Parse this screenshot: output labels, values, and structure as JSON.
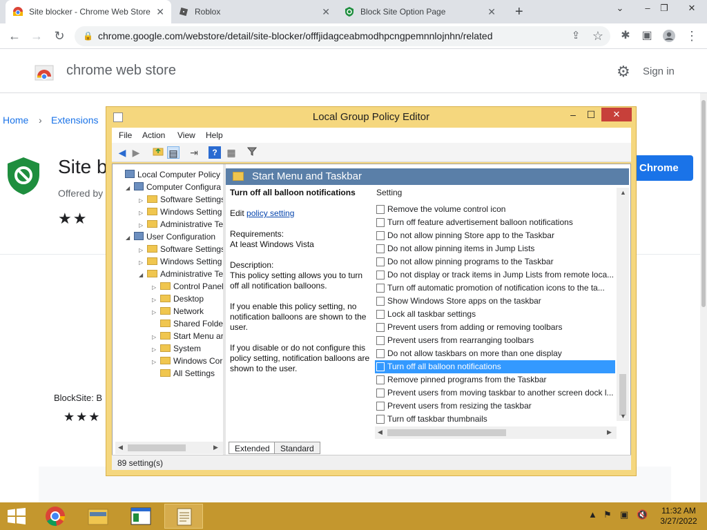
{
  "browser": {
    "tabs": [
      {
        "title": "Site blocker - Chrome Web Store",
        "active": true
      },
      {
        "title": "Roblox",
        "active": false
      },
      {
        "title": "Block Site Option Page",
        "active": false
      }
    ],
    "new_tab": "+",
    "url": "chrome.google.com/webstore/detail/site-blocker/offfjidagceabmodhpcngpemnnlojnhn/related"
  },
  "store": {
    "title": "chrome web store",
    "sign_in": "Sign in",
    "breadcrumb": [
      "Home",
      "Extensions"
    ],
    "ext_title": "Site b",
    "offered_by": "Offered by",
    "add_button": "Chrome",
    "stars": "★★",
    "related_label": "BlockSite: B",
    "related_stars": "★★★"
  },
  "gpe": {
    "title": "Local Group Policy Editor",
    "menu": [
      "File",
      "Action",
      "View",
      "Help"
    ],
    "tree": [
      {
        "label": "Local Computer Policy",
        "level": 0,
        "icon": "computer",
        "arrow": ""
      },
      {
        "label": "Computer Configura",
        "level": 1,
        "icon": "computer",
        "arrow": "◢"
      },
      {
        "label": "Software Settings",
        "level": 2,
        "icon": "folder",
        "arrow": "▷"
      },
      {
        "label": "Windows Setting",
        "level": 2,
        "icon": "folder",
        "arrow": "▷"
      },
      {
        "label": "Administrative Te",
        "level": 2,
        "icon": "folder",
        "arrow": "▷"
      },
      {
        "label": "User Configuration",
        "level": 1,
        "icon": "computer",
        "arrow": "◢"
      },
      {
        "label": "Software Settings",
        "level": 2,
        "icon": "folder",
        "arrow": "▷"
      },
      {
        "label": "Windows Setting",
        "level": 2,
        "icon": "folder",
        "arrow": "▷"
      },
      {
        "label": "Administrative Te",
        "level": 2,
        "icon": "folder",
        "arrow": "◢"
      },
      {
        "label": "Control Panel",
        "level": 3,
        "icon": "folder",
        "arrow": "▷"
      },
      {
        "label": "Desktop",
        "level": 3,
        "icon": "folder",
        "arrow": "▷"
      },
      {
        "label": "Network",
        "level": 3,
        "icon": "folder",
        "arrow": "▷"
      },
      {
        "label": "Shared Folder",
        "level": 3,
        "icon": "folder",
        "arrow": ""
      },
      {
        "label": "Start Menu ar",
        "level": 3,
        "icon": "folder",
        "arrow": "▷"
      },
      {
        "label": "System",
        "level": 3,
        "icon": "folder",
        "arrow": "▷"
      },
      {
        "label": "Windows Cor",
        "level": 3,
        "icon": "folder",
        "arrow": "▷"
      },
      {
        "label": "All Settings",
        "level": 3,
        "icon": "folder",
        "arrow": ""
      }
    ],
    "pane_header": "Start Menu and Taskbar",
    "desc": {
      "title": "Turn off all balloon notifications",
      "edit_prefix": "Edit",
      "edit_link": "policy setting",
      "req_label": "Requirements:",
      "req_value": "At least Windows Vista",
      "desc_label": "Description:",
      "desc_text": "This policy setting allows you to turn off all notification balloons.",
      "enable_text": "If you enable this policy setting, no notification balloons are shown to the user.",
      "disable_text": "If you disable or do not configure this policy setting, notification balloons are shown to the user."
    },
    "column_header": "Setting",
    "settings": [
      "Remove the volume control icon",
      "Turn off feature advertisement balloon notifications",
      "Do not allow pinning Store app to the Taskbar",
      "Do not allow pinning items in Jump Lists",
      "Do not allow pinning programs to the Taskbar",
      "Do not display or track items in Jump Lists from remote loca...",
      "Turn off automatic promotion of notification icons to the ta...",
      "Show Windows Store apps on the taskbar",
      "Lock all taskbar settings",
      "Prevent users from adding or removing toolbars",
      "Prevent users from rearranging toolbars",
      "Do not allow taskbars on more than one display",
      "Turn off all balloon notifications",
      "Remove pinned programs from the Taskbar",
      "Prevent users from moving taskbar to another screen dock l...",
      "Prevent users from resizing the taskbar",
      "Turn off taskbar thumbnails"
    ],
    "selected_index": 12,
    "view_tabs": [
      "Extended",
      "Standard"
    ],
    "status": "89 setting(s)"
  },
  "taskbar": {
    "time": "11:32 AM",
    "date": "3/27/2022"
  },
  "colors": {
    "chrome_blue": "#1a73e8",
    "selection": "#3399ff",
    "window_frame": "#f5d77e",
    "close_red": "#c7403a",
    "taskbar": "#c4972e"
  }
}
